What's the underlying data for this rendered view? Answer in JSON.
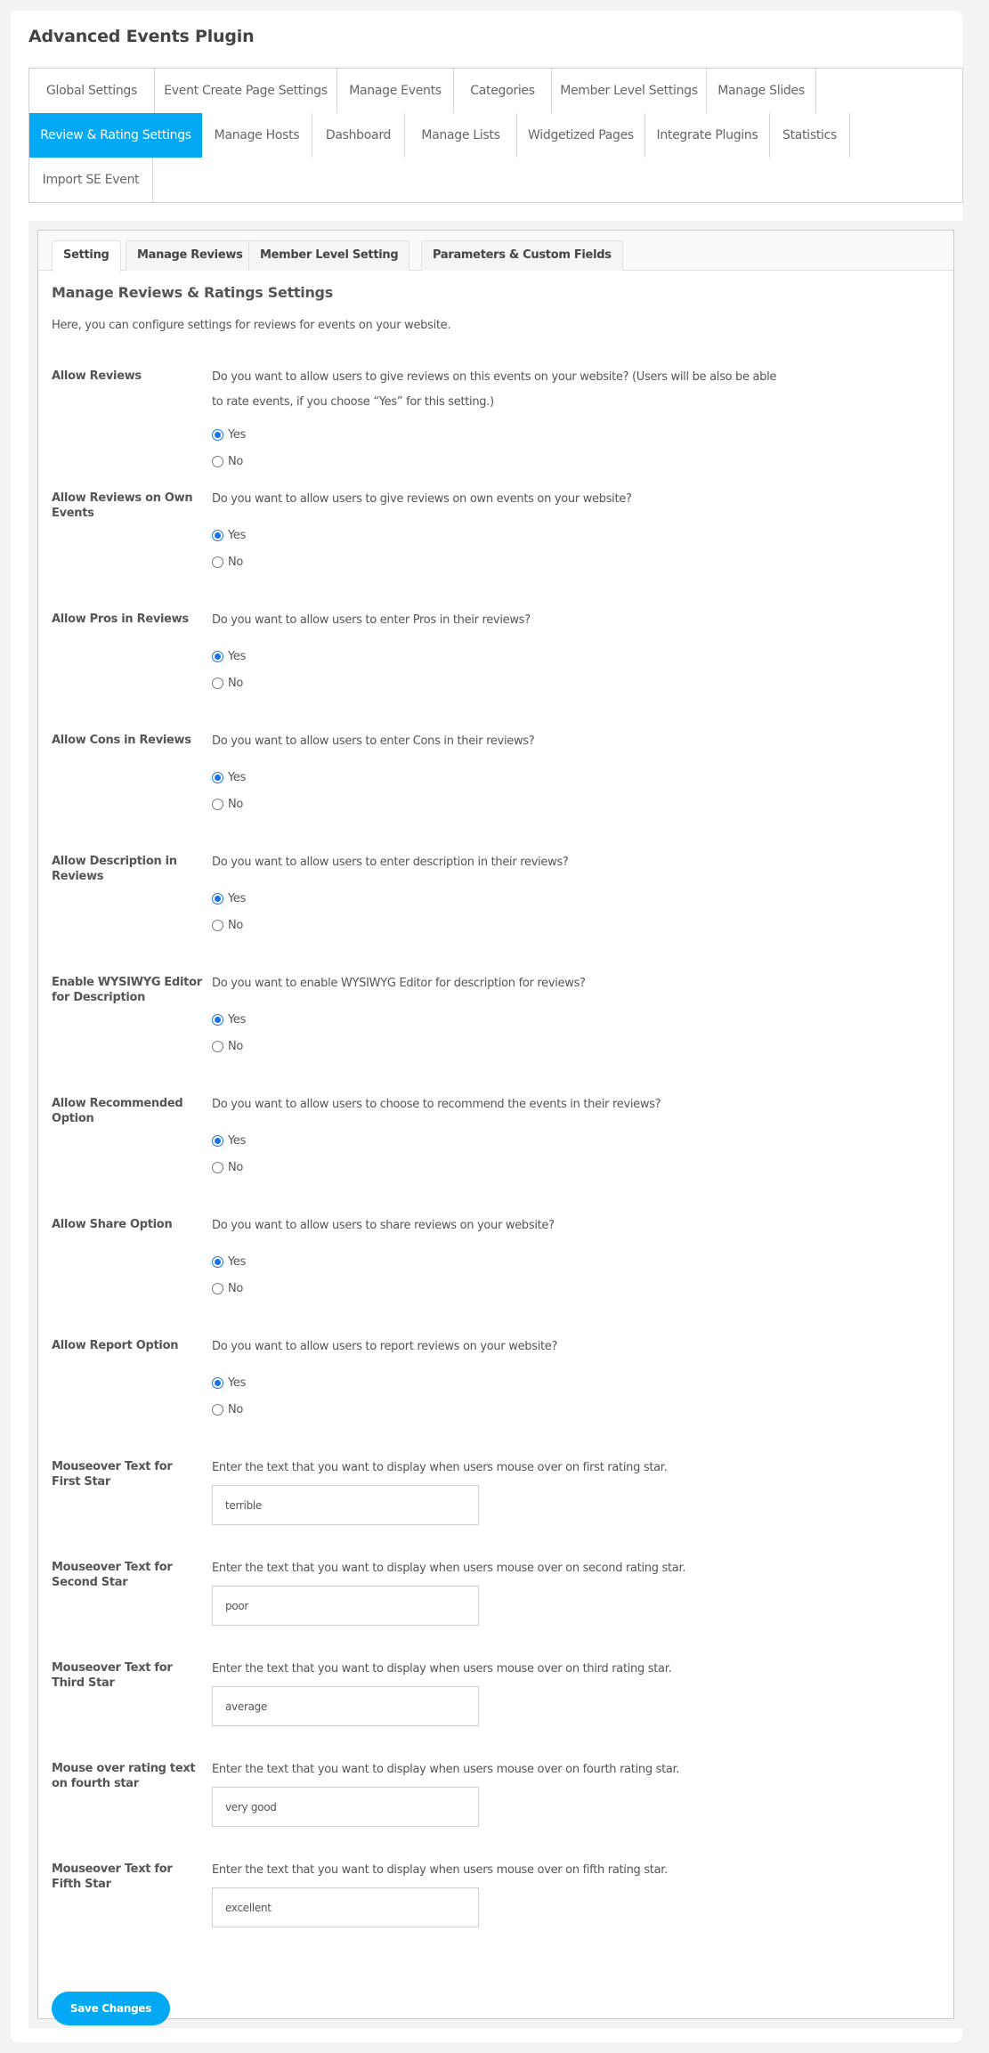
{
  "page": {
    "title": "Advanced Events Plugin"
  },
  "main_tabs": [
    {
      "label": "Global Settings"
    },
    {
      "label": "Event Create Page Settings"
    },
    {
      "label": "Manage Events"
    },
    {
      "label": "Categories"
    },
    {
      "label": "Member Level Settings"
    },
    {
      "label": "Manage Slides"
    },
    {
      "label": "Review & Rating Settings",
      "active": true
    },
    {
      "label": "Manage Hosts"
    },
    {
      "label": "Dashboard"
    },
    {
      "label": "Manage Lists"
    },
    {
      "label": "Widgetized Pages"
    },
    {
      "label": "Integrate Plugins"
    },
    {
      "label": "Statistics"
    },
    {
      "label": "Import SE Event"
    }
  ],
  "sub_tabs": [
    {
      "label": "Setting",
      "active": true
    },
    {
      "label": "Manage Reviews"
    },
    {
      "label": "Member Level Setting"
    },
    {
      "label": "Parameters & Custom Fields"
    }
  ],
  "section": {
    "title": "Manage Reviews & Ratings Settings",
    "description": "Here, you can configure settings for reviews for events on your website."
  },
  "radio_settings": [
    {
      "label": "Allow Reviews",
      "description": "Do you want to allow users to give reviews on this events on your website? (Users will be also be able to rate events, if you choose “Yes” for this setting.)",
      "options": [
        "Yes",
        "No"
      ],
      "selected": "Yes"
    },
    {
      "label": "Allow Reviews on Own Events",
      "description": "Do you want to allow users to give reviews on own events on your website?",
      "options": [
        "Yes",
        "No"
      ],
      "selected": "Yes"
    },
    {
      "label": "Allow Pros in Reviews",
      "description": "Do you want to allow users to enter Pros in their reviews?",
      "options": [
        "Yes",
        "No"
      ],
      "selected": "Yes"
    },
    {
      "label": "Allow Cons in Reviews",
      "description": "Do you want to allow users to enter Cons in their reviews?",
      "options": [
        "Yes",
        "No"
      ],
      "selected": "Yes"
    },
    {
      "label": "Allow Description in Reviews",
      "description": "Do you want to allow users to enter description in their reviews?",
      "options": [
        "Yes",
        "No"
      ],
      "selected": "Yes"
    },
    {
      "label": "Enable WYSIWYG Editor for Description",
      "description": "Do you want to enable WYSIWYG Editor for description for reviews?",
      "options": [
        "Yes",
        "No"
      ],
      "selected": "Yes"
    },
    {
      "label": "Allow Recommended Option",
      "description": "Do you want to allow users to choose to recommend the events in their reviews?",
      "options": [
        "Yes",
        "No"
      ],
      "selected": "Yes"
    },
    {
      "label": "Allow Share Option",
      "description": "Do you want to allow users to share reviews on your website?",
      "options": [
        "Yes",
        "No"
      ],
      "selected": "Yes"
    },
    {
      "label": "Allow Report Option",
      "description": "Do you want to allow users to report reviews on your website?",
      "options": [
        "Yes",
        "No"
      ],
      "selected": "Yes"
    }
  ],
  "text_settings": [
    {
      "label": "Mouseover Text for First Star",
      "description": "Enter the text that you want to display when users mouse over on first rating star.",
      "value": "terrible"
    },
    {
      "label": "Mouseover Text for Second Star",
      "description": "Enter the text that you want to display when users mouse over on second rating star.",
      "value": "poor"
    },
    {
      "label": "Mouseover Text for Third Star",
      "description": "Enter the text that you want to display when users mouse over on third rating star.",
      "value": "average"
    },
    {
      "label": "Mouse over rating text on fourth star",
      "description": "Enter the text that you want to display when users mouse over on fourth rating star.",
      "value": "very good"
    },
    {
      "label": "Mouseover Text for Fifth Star",
      "description": "Enter the text that you want to display when users mouse over on fifth rating star.",
      "value": "excellent"
    }
  ],
  "save_button": {
    "label": "Save Changes"
  },
  "colors": {
    "accent": "#03a9f4",
    "radio_checked": "#1a73e8"
  }
}
